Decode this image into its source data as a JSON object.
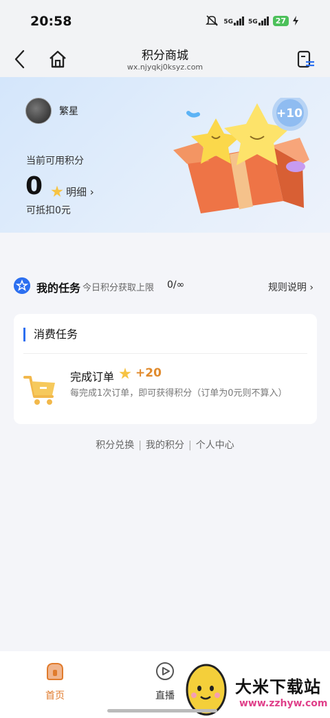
{
  "status_bar": {
    "time": "20:58",
    "network_1": "5G",
    "network_2": "5G",
    "battery": "27"
  },
  "nav": {
    "title": "积分商城",
    "url": "wx.njyqkj0ksyz.com"
  },
  "user": {
    "name": "繁星"
  },
  "points": {
    "label": "当前可用积分",
    "value": "0",
    "detail_label": "明细 ›",
    "deduct_text": "可抵扣0元"
  },
  "gift": {
    "bubble_text": "+10"
  },
  "tasks": {
    "title": "我的任务",
    "limit_label": "今日积分获取上限",
    "limit_value": "0/∞",
    "rules_label": "规则说明 ›"
  },
  "card": {
    "section_title": "消费任务",
    "order_title": "完成订单",
    "order_points": "+20",
    "order_desc": "每完成1次订单，即可获得积分（订单为0元则不算入）"
  },
  "footer_links": [
    "积分兑换",
    "我的积分",
    "个人中心"
  ],
  "tabs": [
    {
      "label": "首页"
    },
    {
      "label": "直播"
    }
  ],
  "watermark": {
    "title": "大米下载站",
    "url": "www.zzhyw.com"
  },
  "colors": {
    "accent": "#2c6ff0",
    "orange": "#e07b2c",
    "points_orange": "#e08a2c"
  }
}
